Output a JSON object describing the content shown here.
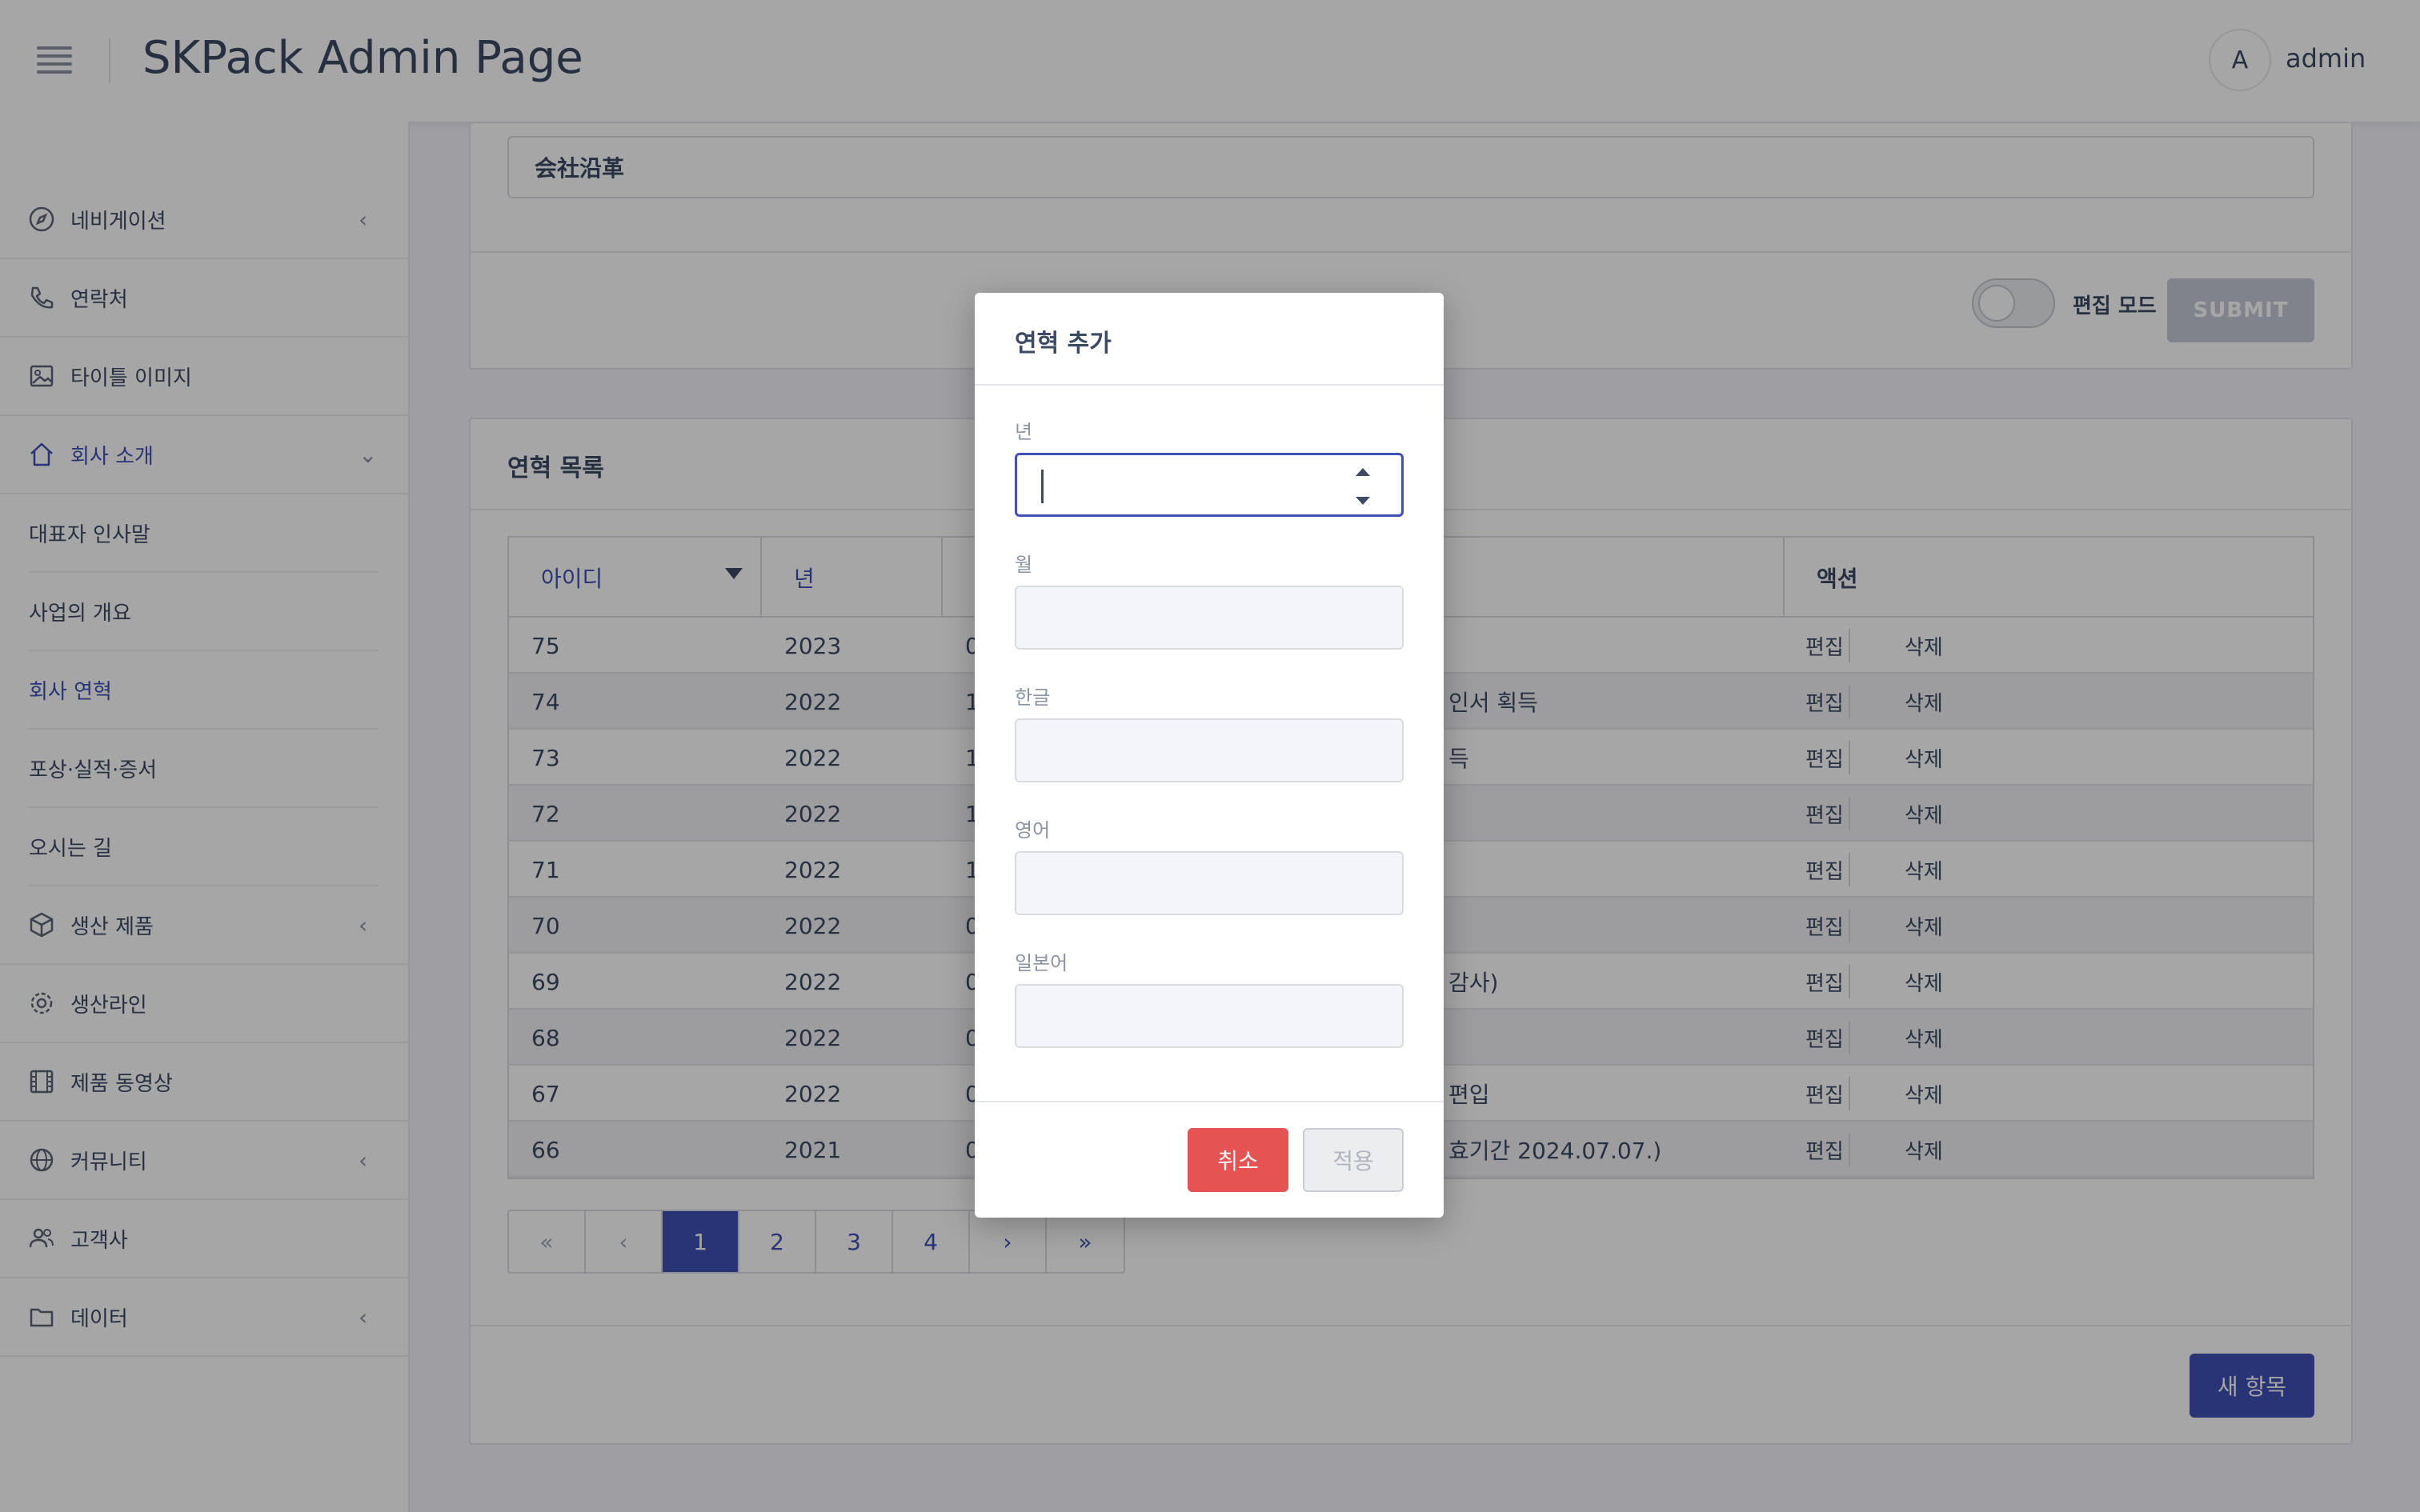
{
  "header": {
    "title": "SKPack Admin Page",
    "avatar_initial": "A",
    "user": "admin"
  },
  "sidebar": {
    "items": [
      {
        "label": "네비게이션",
        "icon": "compass-icon",
        "chevron": "‹"
      },
      {
        "label": "연락처",
        "icon": "phone-icon"
      },
      {
        "label": "타이틀 이미지",
        "icon": "image-icon"
      },
      {
        "label": "회사 소개",
        "icon": "home-icon",
        "chevron": "⌄"
      },
      {
        "label": "생산 제품",
        "icon": "box-icon",
        "chevron": "‹"
      },
      {
        "label": "생산라인",
        "icon": "gear-icon"
      },
      {
        "label": "제품 동영상",
        "icon": "film-icon"
      },
      {
        "label": "커뮤니티",
        "icon": "globe-icon",
        "chevron": "‹"
      },
      {
        "label": "고객사",
        "icon": "people-icon"
      },
      {
        "label": "데이터",
        "icon": "folder-icon",
        "chevron": "‹"
      }
    ],
    "subitems": [
      {
        "label": "대표자 인사말"
      },
      {
        "label": "사업의 개요"
      },
      {
        "label": "회사 연혁"
      },
      {
        "label": "포상·실적·증서"
      },
      {
        "label": "오시는 길"
      }
    ]
  },
  "top_card": {
    "title_value": "会社沿革",
    "edit_mode_label": "편집 모드",
    "submit_label": "SUBMIT"
  },
  "list": {
    "title": "연혁 목록",
    "columns": {
      "id": "아이디",
      "year": "년",
      "action": "액션"
    },
    "edit_label": "편집",
    "delete_label": "삭제",
    "rows": [
      {
        "id": "75",
        "year": "2023",
        "month": "0",
        "text": ""
      },
      {
        "id": "74",
        "year": "2022",
        "month": "1",
        "text": "인서 획득"
      },
      {
        "id": "73",
        "year": "2022",
        "month": "1",
        "text": "득"
      },
      {
        "id": "72",
        "year": "2022",
        "month": "1",
        "text": ""
      },
      {
        "id": "71",
        "year": "2022",
        "month": "1",
        "text": ""
      },
      {
        "id": "70",
        "year": "2022",
        "month": "0",
        "text": ""
      },
      {
        "id": "69",
        "year": "2022",
        "month": "0",
        "text": "감사)"
      },
      {
        "id": "68",
        "year": "2022",
        "month": "0",
        "text": ""
      },
      {
        "id": "67",
        "year": "2022",
        "month": "0",
        "text": "편입"
      },
      {
        "id": "66",
        "year": "2021",
        "month": "0",
        "text": "효기간 2024.07.07.)"
      }
    ],
    "pagination": [
      "«",
      "‹",
      "1",
      "2",
      "3",
      "4",
      "›",
      "»"
    ],
    "new_button": "새 항목"
  },
  "modal": {
    "title": "연혁 추가",
    "fields": [
      {
        "label": "년",
        "value": ""
      },
      {
        "label": "월",
        "value": ""
      },
      {
        "label": "한글",
        "value": ""
      },
      {
        "label": "영어",
        "value": ""
      },
      {
        "label": "일본어",
        "value": ""
      }
    ],
    "cancel_label": "취소",
    "apply_label": "적용"
  },
  "colors": {
    "primary": "#3f51b5",
    "danger": "#e55353",
    "text": "#3c4b64"
  }
}
